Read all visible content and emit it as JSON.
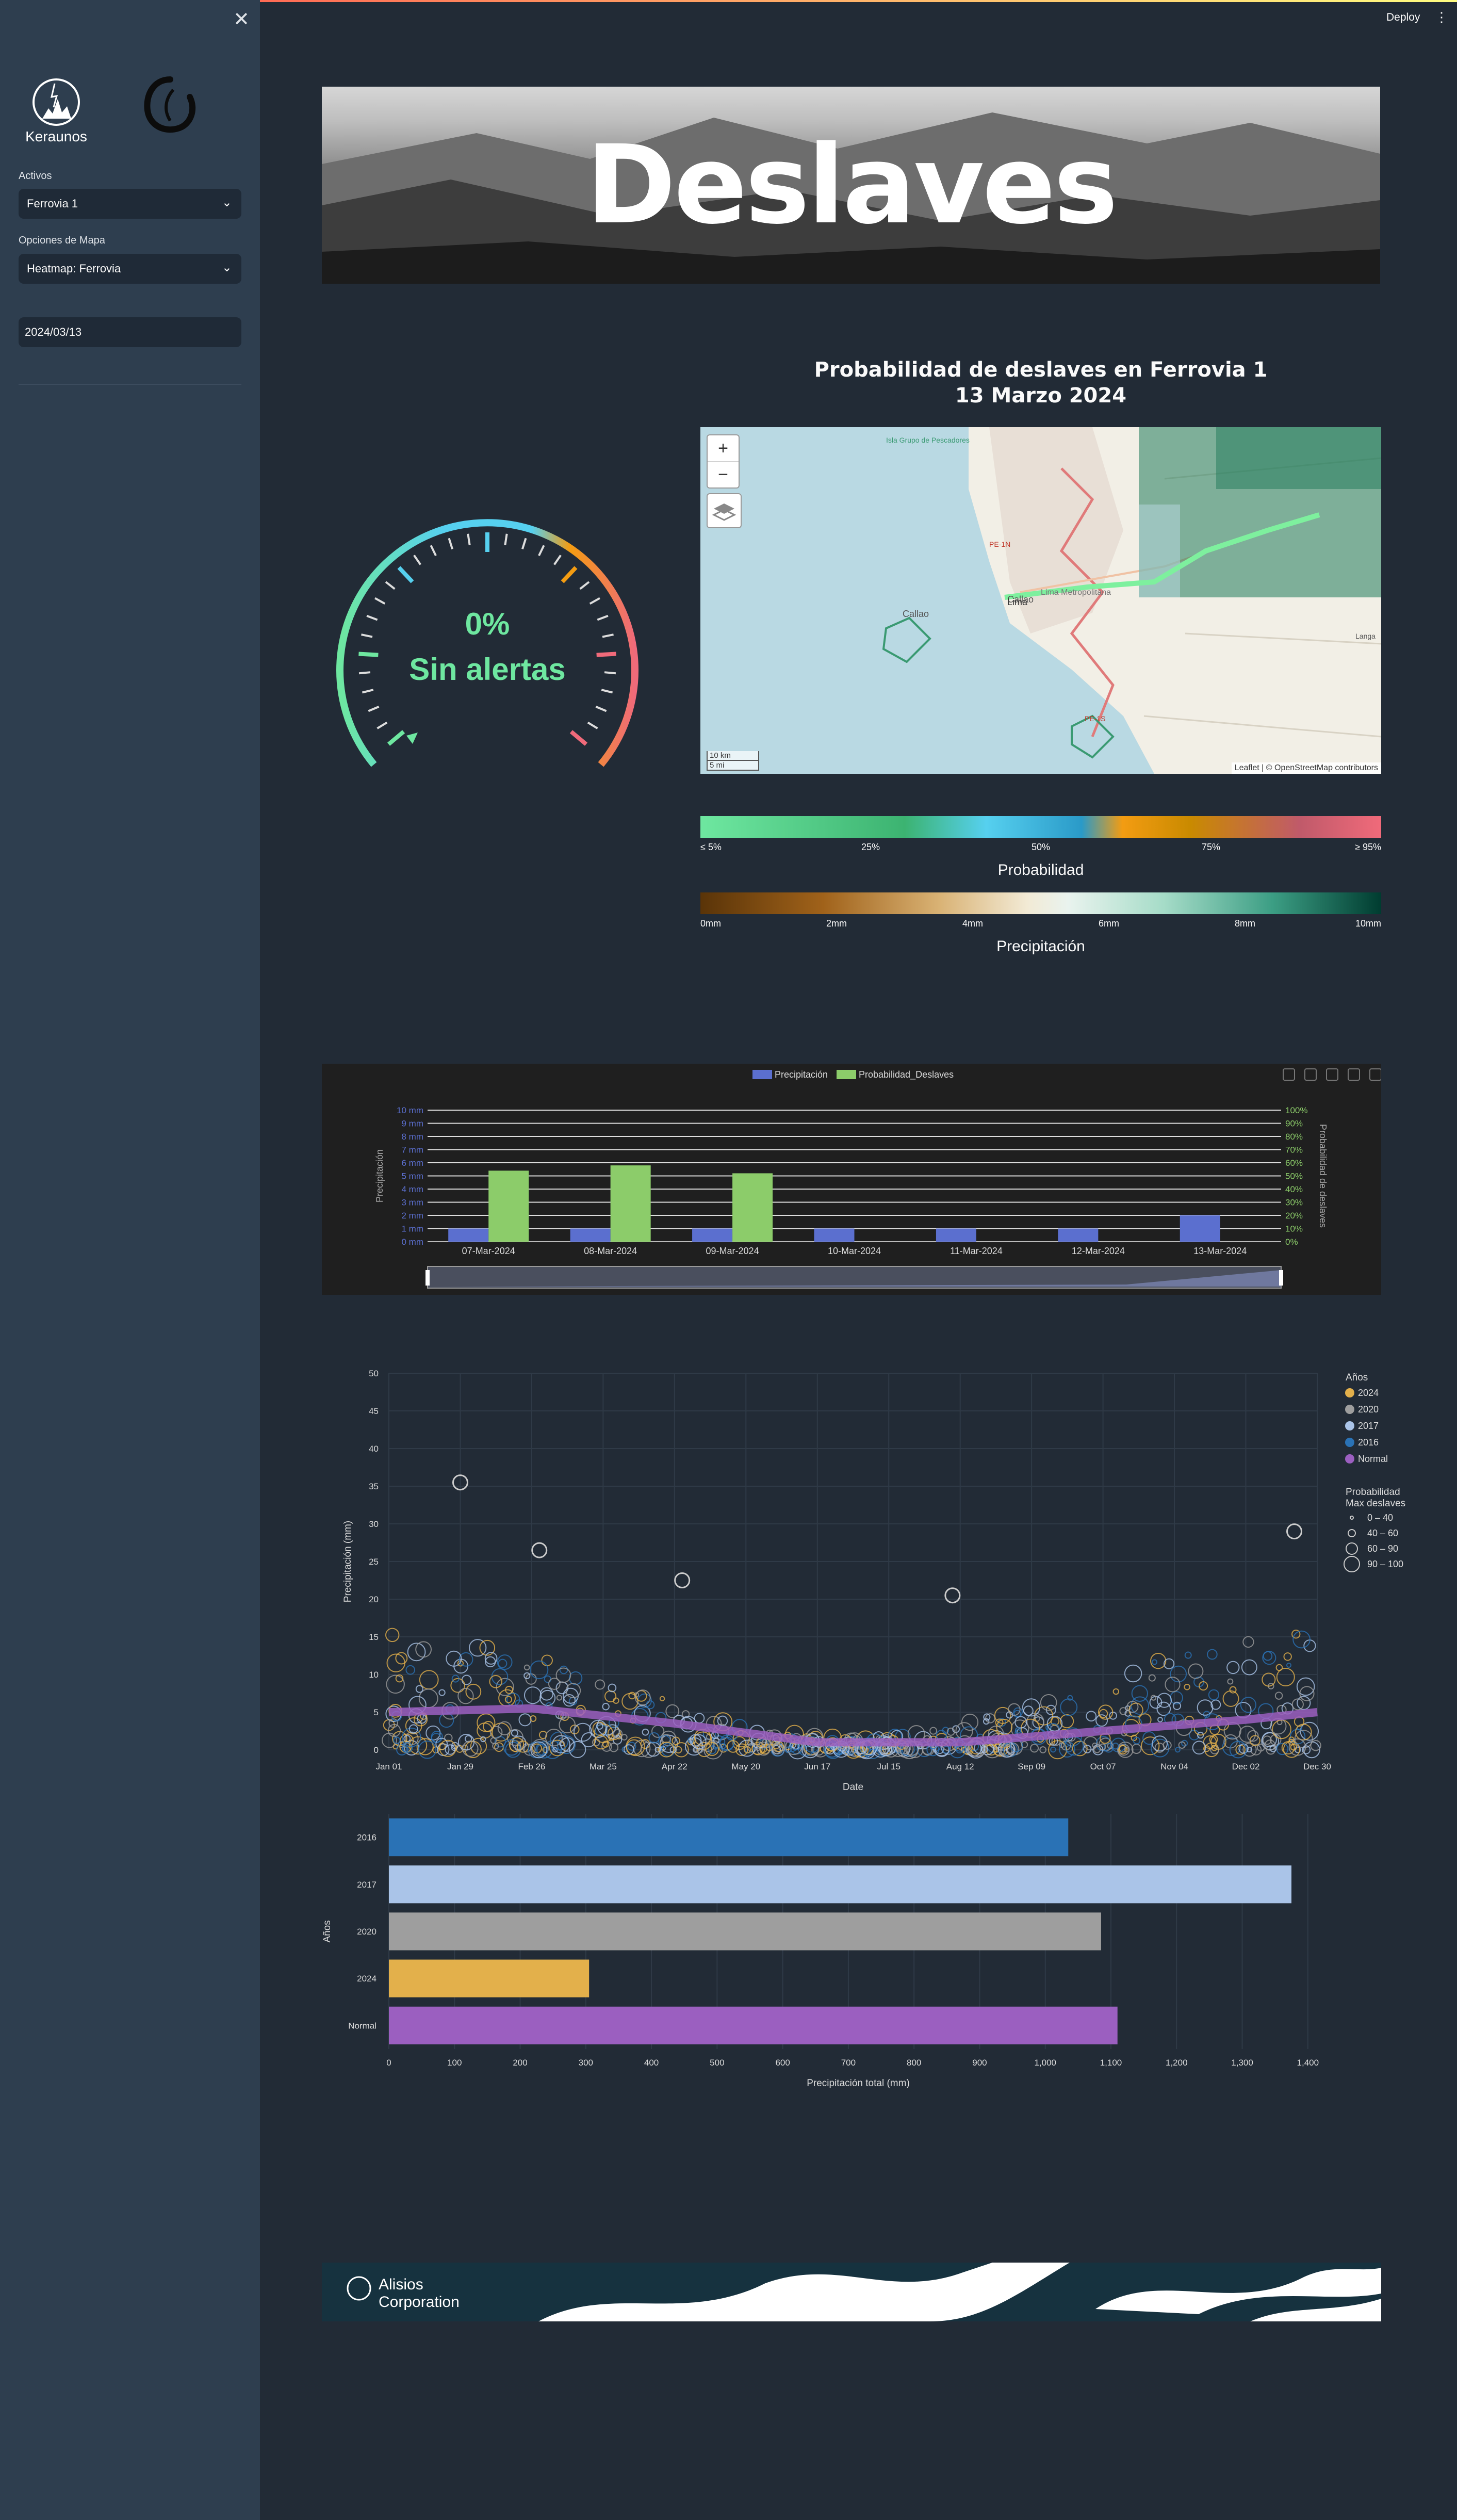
{
  "sidebar": {
    "close_label": "✕",
    "logo_text": "Keraunos",
    "activos_label": "Activos",
    "activos_value": "Ferrovia 1",
    "mapa_label": "Opciones de Mapa",
    "mapa_value": "Heatmap: Ferrovia",
    "date_value": "2024/03/13"
  },
  "header": {
    "deploy_label": "Deploy",
    "menu_label": "⋮"
  },
  "banner": {
    "title": "Deslaves"
  },
  "map": {
    "title_line1": "Probabilidad de deslaves en Ferrovia 1",
    "title_line2": "13 Marzo 2024",
    "zoom_in": "+",
    "zoom_out": "−",
    "attribution": "Leaflet | © OpenStreetMap contributors",
    "scale_km": "10 km",
    "scale_mi": "5 mi",
    "place_labels": [
      "Lima",
      "Callao",
      "Lima Metropolitana",
      "PE-1N",
      "PE-1S",
      "Isla Grupo de Pescadores",
      "Langa"
    ]
  },
  "gauge": {
    "value_text": "0%",
    "status_text": "Sin alertas",
    "value": 0
  },
  "colorbars": {
    "probabilidad": {
      "title": "Probabilidad",
      "ticks": [
        "≤ 5%",
        "25%",
        "50%",
        "75%",
        "≥ 95%"
      ]
    },
    "precipitacion": {
      "title": "Precipitación",
      "ticks": [
        "0mm",
        "2mm",
        "4mm",
        "6mm",
        "8mm",
        "10mm"
      ]
    }
  },
  "chart_data": [
    {
      "type": "bar",
      "legend": [
        "Precipitación",
        "Probabilidad_Deslaves"
      ],
      "categories": [
        "07-Mar-2024",
        "08-Mar-2024",
        "09-Mar-2024",
        "10-Mar-2024",
        "11-Mar-2024",
        "12-Mar-2024",
        "13-Mar-2024"
      ],
      "series": [
        {
          "name": "Precipitación",
          "axis": "left",
          "values": [
            1,
            1,
            1,
            1,
            1,
            1,
            2
          ]
        },
        {
          "name": "Probabilidad_Deslaves",
          "axis": "right",
          "values": [
            54,
            58,
            52,
            0,
            0,
            0,
            0
          ]
        }
      ],
      "ylabel": "Precipitación",
      "y2label": "Probabilidad de deslaves",
      "yticks": [
        "0 mm",
        "1 mm",
        "2 mm",
        "3 mm",
        "4 mm",
        "5 mm",
        "6 mm",
        "7 mm",
        "8 mm",
        "9 mm",
        "10 mm"
      ],
      "y2ticks": [
        "0%",
        "10%",
        "20%",
        "30%",
        "40%",
        "50%",
        "60%",
        "70%",
        "80%",
        "90%",
        "100%"
      ],
      "ylim": [
        0,
        10
      ],
      "y2lim": [
        0,
        100
      ],
      "colors": {
        "Precipitación": "#5b6fcf",
        "Probabilidad_Deslaves": "#8ccc6a"
      },
      "modebar_icons": [
        "camera-icon",
        "zoom-icon",
        "bar-icon",
        "reset-icon",
        "download-icon"
      ]
    },
    {
      "type": "scatter",
      "xlabel": "Date",
      "ylabel": "Precipitación (mm)",
      "xticks": [
        "Jan 01",
        "Jan 29",
        "Feb 26",
        "Mar 25",
        "Apr 22",
        "May 20",
        "Jun 17",
        "Jul 15",
        "Aug 12",
        "Sep 09",
        "Oct 07",
        "Nov 04",
        "Dec 02",
        "Dec 30"
      ],
      "yticks": [
        0,
        5,
        10,
        15,
        20,
        25,
        30,
        35,
        40,
        45,
        50
      ],
      "ylim": [
        0,
        50
      ],
      "legend_title": "Años",
      "legend": [
        {
          "name": "2024",
          "color": "#e3b04b"
        },
        {
          "name": "2020",
          "color": "#9e9e9e"
        },
        {
          "name": "2017",
          "color": "#aac4e8"
        },
        {
          "name": "2016",
          "color": "#2a72b5"
        },
        {
          "name": "Normal",
          "color": "#9b5fc0"
        }
      ],
      "size_legend_title": "Probabilidad",
      "size_legend_subtitle": "Max deslaves",
      "size_legend": [
        "0 – 40",
        "40 – 60",
        "60 – 90",
        "90 – 100"
      ],
      "notable_points": [
        {
          "x": "Jan 29",
          "y": 35.5
        },
        {
          "x": "Dec 22",
          "y": 29
        },
        {
          "x": "Mar 01",
          "y": 26.5
        },
        {
          "x": "Apr 26",
          "y": 22.5
        },
        {
          "x": "Aug 10",
          "y": 20.5
        }
      ],
      "normal_curve": [
        {
          "x": "Jan 01",
          "y": 5
        },
        {
          "x": "Feb 26",
          "y": 5.5
        },
        {
          "x": "Apr 22",
          "y": 3.5
        },
        {
          "x": "Jun 17",
          "y": 1
        },
        {
          "x": "Aug 12",
          "y": 1
        },
        {
          "x": "Oct 07",
          "y": 2.5
        },
        {
          "x": "Dec 02",
          "y": 4
        },
        {
          "x": "Dec 30",
          "y": 5
        }
      ]
    },
    {
      "type": "bar",
      "orientation": "horizontal",
      "categories": [
        "2016",
        "2017",
        "2020",
        "2024",
        "Normal"
      ],
      "values": [
        1035,
        1375,
        1085,
        305,
        1110
      ],
      "colors": [
        "#2a72b5",
        "#aac4e8",
        "#9e9e9e",
        "#e3b04b",
        "#9b5fc0"
      ],
      "xlabel": "Precipitación total (mm)",
      "ylabel": "Años",
      "xticks": [
        "0",
        "100",
        "200",
        "300",
        "400",
        "500",
        "600",
        "700",
        "800",
        "900",
        "1,000",
        "1,100",
        "1,200",
        "1,300",
        "1,400"
      ],
      "xlim": [
        0,
        1430
      ]
    }
  ],
  "footer": {
    "brand_line1": "Alisios",
    "brand_line2": "Corporation"
  }
}
